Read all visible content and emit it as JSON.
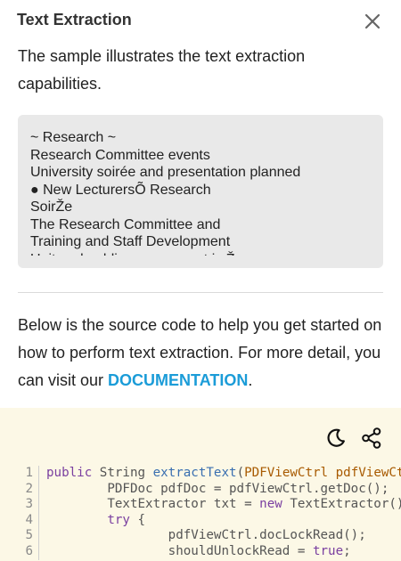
{
  "header": {
    "title": "Text Extraction",
    "close_icon": "close-icon"
  },
  "intro": "The sample illustrates the text extraction capabilities.",
  "output_lines": [
    "~ Research ~",
    "Research Committee events",
    "University soirée and presentation planned",
    "● New LecturersÕ Research",
    "SoirŽe",
    "The Research Committee and",
    "Training and Staff Development",
    "Unit and public engagement is Ž"
  ],
  "source_intro": {
    "text": "Below is the source code to help you get started on how to perform text extraction. For more detail, you can visit our ",
    "link": "DOCUMENTATION",
    "suffix": "."
  },
  "code_panel": {
    "theme_icon": "moon-icon",
    "share_icon": "share-icon",
    "lines": [
      {
        "n": "1",
        "tokens": [
          {
            "t": "public",
            "c": "kw"
          },
          {
            "t": " String ",
            "c": "plain"
          },
          {
            "t": "extractText",
            "c": "fn"
          },
          {
            "t": "(",
            "c": "plain"
          },
          {
            "t": "PDFViewCtrl pdfViewCtrl",
            "c": "ty"
          }
        ]
      },
      {
        "n": "2",
        "tokens": [
          {
            "t": "        PDFDoc pdfDoc = pdfViewCtrl.getDoc();",
            "c": "plain"
          }
        ]
      },
      {
        "n": "3",
        "tokens": [
          {
            "t": "        TextExtractor txt = ",
            "c": "plain"
          },
          {
            "t": "new",
            "c": "kw"
          },
          {
            "t": " TextExtractor();",
            "c": "plain"
          }
        ]
      },
      {
        "n": "4",
        "tokens": [
          {
            "t": "        ",
            "c": "plain"
          },
          {
            "t": "try",
            "c": "kw"
          },
          {
            "t": " {",
            "c": "plain"
          }
        ]
      },
      {
        "n": "5",
        "tokens": [
          {
            "t": "                pdfViewCtrl.docLockRead();",
            "c": "plain"
          }
        ]
      },
      {
        "n": "6",
        "tokens": [
          {
            "t": "                shouldUnlockRead = ",
            "c": "plain"
          },
          {
            "t": "true",
            "c": "kw"
          },
          {
            "t": ";",
            "c": "plain"
          }
        ]
      }
    ]
  },
  "colors": {
    "link": "#1b9cd8",
    "code_background": "#fcf8e6",
    "output_background": "#e9e9e9"
  }
}
